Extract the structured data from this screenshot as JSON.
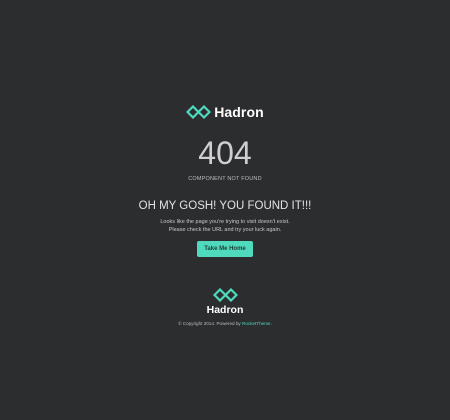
{
  "brand": {
    "name": "Hadron",
    "accent_color": "#4fd9bd",
    "icon": "hadron-logo-icon"
  },
  "error": {
    "code": "404",
    "subtitle": "COMPONENT NOT FOUND",
    "headline": "OH MY GOSH! YOU FOUND IT!!!",
    "message_line1": "Looks like the page you're trying to visit doesn't exist.",
    "message_line2": "Please check the URL and try your luck again."
  },
  "actions": {
    "home_label": "Take Me Home"
  },
  "footer": {
    "brand_name": "Hadron",
    "copyright_text": "© Copyright 2014. Powered by",
    "powered_by_link": "RocketTheme."
  },
  "colors": {
    "background": "#2c2d2f",
    "accent": "#4fd9bd",
    "text": "#d8d8d8"
  }
}
